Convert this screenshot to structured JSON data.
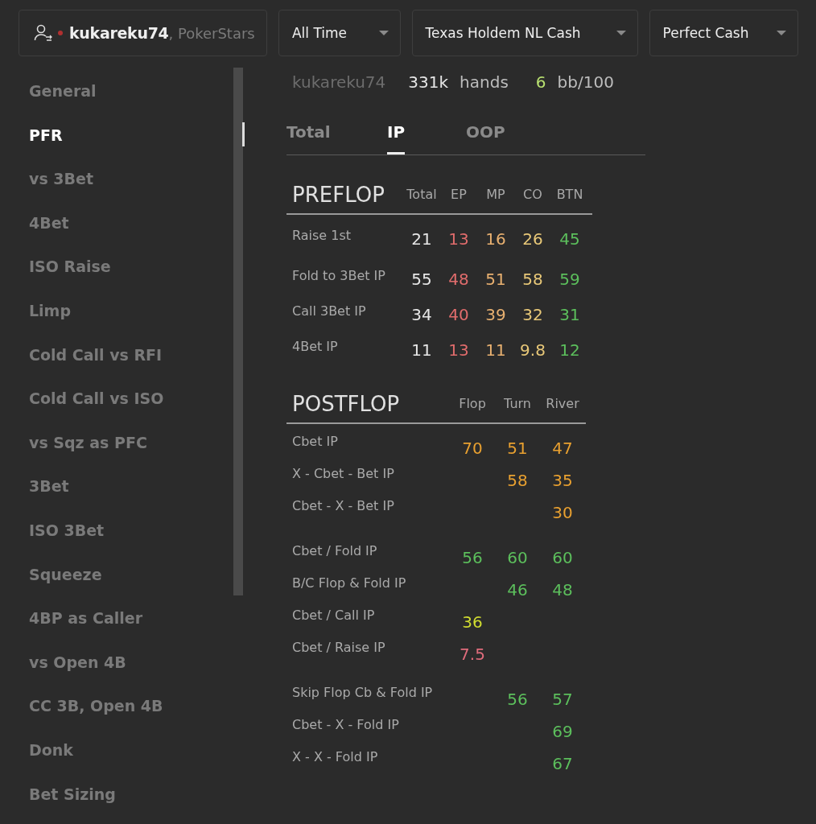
{
  "header": {
    "player": "kukareku74",
    "site": ", PokerStars",
    "online": false,
    "filters": [
      {
        "label": "All Time"
      },
      {
        "label": "Texas Holdem NL Cash"
      },
      {
        "label": "Perfect Cash"
      }
    ]
  },
  "sidebar": {
    "items": [
      {
        "label": "General",
        "selected": false
      },
      {
        "label": "PFR",
        "selected": true
      },
      {
        "label": "vs 3Bet",
        "selected": false
      },
      {
        "label": "4Bet",
        "selected": false
      },
      {
        "label": "ISO Raise",
        "selected": false
      },
      {
        "label": "Limp",
        "selected": false
      },
      {
        "label": "Cold Call vs RFI",
        "selected": false
      },
      {
        "label": "Cold Call vs ISO",
        "selected": false
      },
      {
        "label": "vs Sqz as PFC",
        "selected": false
      },
      {
        "label": "3Bet",
        "selected": false
      },
      {
        "label": "ISO 3Bet",
        "selected": false
      },
      {
        "label": "Squeeze",
        "selected": false
      },
      {
        "label": "4BP as Caller",
        "selected": false
      },
      {
        "label": "vs Open 4B",
        "selected": false
      },
      {
        "label": "CC 3B, Open 4B",
        "selected": false
      },
      {
        "label": "Donk",
        "selected": false
      },
      {
        "label": "Bet Sizing",
        "selected": false
      }
    ]
  },
  "summary": {
    "player": "kukareku74",
    "hands": "331k",
    "hands_label": "hands",
    "winrate": "6",
    "winrate_label": "bb/100"
  },
  "tabs": [
    {
      "label": "Total",
      "selected": false
    },
    {
      "label": "IP",
      "selected": true
    },
    {
      "label": "OOP",
      "selected": false
    }
  ],
  "preflop": {
    "title": "PREFLOP",
    "columns": [
      "Total",
      "EP",
      "MP",
      "CO",
      "BTN"
    ],
    "rows": [
      {
        "label": "Raise 1st",
        "cells": [
          {
            "value": "21",
            "color": "#e6e6e6"
          },
          {
            "value": "13",
            "color": "#e06c6c"
          },
          {
            "value": "16",
            "color": "#e8b070"
          },
          {
            "value": "26",
            "color": "#e8c878"
          },
          {
            "value": "45",
            "color": "#5cbf5c"
          }
        ]
      },
      {
        "label": "Fold to 3Bet IP",
        "cells": [
          {
            "value": "55",
            "color": "#e6e6e6"
          },
          {
            "value": "48",
            "color": "#e06c6c"
          },
          {
            "value": "51",
            "color": "#e8b070"
          },
          {
            "value": "58",
            "color": "#e8c878"
          },
          {
            "value": "59",
            "color": "#5cbf5c"
          }
        ]
      },
      {
        "label": "Call 3Bet IP",
        "cells": [
          {
            "value": "34",
            "color": "#e6e6e6"
          },
          {
            "value": "40",
            "color": "#e06c6c"
          },
          {
            "value": "39",
            "color": "#e8b070"
          },
          {
            "value": "32",
            "color": "#e8c878"
          },
          {
            "value": "31",
            "color": "#5cbf5c"
          }
        ]
      },
      {
        "label": "4Bet IP",
        "cells": [
          {
            "value": "11",
            "color": "#e6e6e6"
          },
          {
            "value": "13",
            "color": "#e06c6c"
          },
          {
            "value": "11",
            "color": "#e8b070"
          },
          {
            "value": "9.8",
            "color": "#e8c878"
          },
          {
            "value": "12",
            "color": "#5cbf5c"
          }
        ]
      }
    ]
  },
  "postflop": {
    "title": "POSTFLOP",
    "columns": [
      "Flop",
      "Turn",
      "River"
    ],
    "groups": [
      [
        {
          "label": "Cbet IP",
          "cells": [
            {
              "value": "70",
              "color": "#e8a030"
            },
            {
              "value": "51",
              "color": "#e8a030"
            },
            {
              "value": "47",
              "color": "#e8a030"
            }
          ]
        },
        {
          "label": "X - Cbet - Bet IP",
          "cells": [
            null,
            {
              "value": "58",
              "color": "#e8a030"
            },
            {
              "value": "35",
              "color": "#e8a030"
            }
          ]
        },
        {
          "label": "Cbet - X - Bet IP",
          "cells": [
            null,
            null,
            {
              "value": "30",
              "color": "#e8a030"
            }
          ]
        }
      ],
      [
        {
          "label": "Cbet / Fold IP",
          "cells": [
            {
              "value": "56",
              "color": "#5cbf5c"
            },
            {
              "value": "60",
              "color": "#5cbf5c"
            },
            {
              "value": "60",
              "color": "#5cbf5c"
            }
          ]
        },
        {
          "label": "B/C Flop & Fold IP",
          "cells": [
            null,
            {
              "value": "46",
              "color": "#5cbf5c"
            },
            {
              "value": "48",
              "color": "#5cbf5c"
            }
          ]
        },
        {
          "label": "Cbet / Call IP",
          "cells": [
            {
              "value": "36",
              "color": "#d0dc30"
            },
            null,
            null
          ]
        },
        {
          "label": "Cbet / Raise IP",
          "cells": [
            {
              "value": "7.5",
              "color": "#e06c7c"
            },
            null,
            null
          ]
        }
      ],
      [
        {
          "label": "Skip Flop Cb & Fold IP",
          "cells": [
            null,
            {
              "value": "56",
              "color": "#5cbf5c"
            },
            {
              "value": "57",
              "color": "#5cbf5c"
            }
          ]
        },
        {
          "label": "Cbet - X - Fold IP",
          "cells": [
            null,
            null,
            {
              "value": "69",
              "color": "#5cbf5c"
            }
          ]
        },
        {
          "label": "X - X - Fold IP",
          "cells": [
            null,
            null,
            {
              "value": "67",
              "color": "#5cbf5c"
            }
          ]
        }
      ]
    ]
  }
}
